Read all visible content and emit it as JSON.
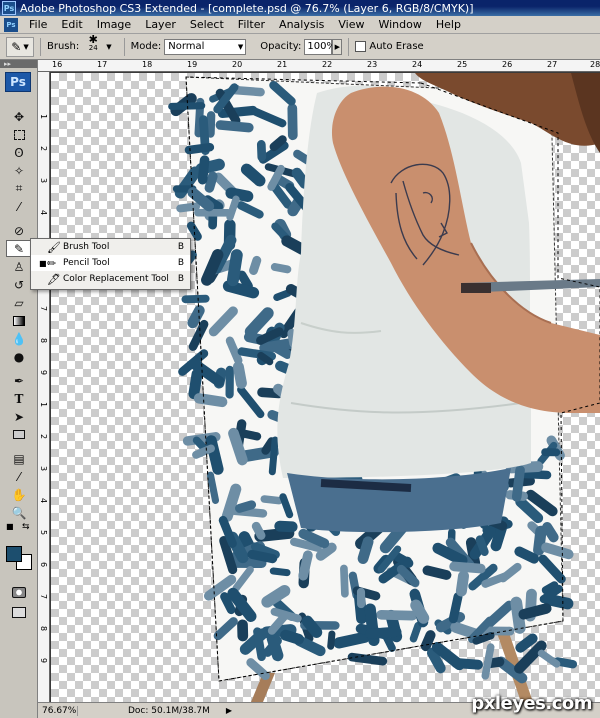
{
  "window": {
    "title": "Adobe Photoshop CS3 Extended - [complete.psd @ 76.7% (Layer 6, RGB/8/CMYK)]",
    "app_badge": "Ps"
  },
  "menubar": {
    "items": [
      "File",
      "Edit",
      "Image",
      "Layer",
      "Select",
      "Filter",
      "Analysis",
      "View",
      "Window",
      "Help"
    ]
  },
  "options": {
    "brush_label": "Brush:",
    "brush_size": "24",
    "mode_label": "Mode:",
    "mode_value": "Normal",
    "opacity_label": "Opacity:",
    "opacity_value": "100%",
    "auto_erase_label": "Auto Erase"
  },
  "toolbox": {
    "logo": "Ps",
    "type_tool_glyph": "T"
  },
  "ruler": {
    "top": [
      "16",
      "17",
      "18",
      "19",
      "20",
      "21",
      "22",
      "23",
      "24",
      "25",
      "26",
      "27",
      "28"
    ],
    "left": [
      "1",
      "2",
      "3",
      "4",
      "5",
      "6",
      "7",
      "8",
      "9",
      "1",
      "2",
      "3",
      "4",
      "5",
      "6",
      "7",
      "8",
      "9",
      "1",
      "2"
    ]
  },
  "flyout": {
    "items": [
      {
        "label": "Brush Tool",
        "key": "B",
        "icon": "brush-icon"
      },
      {
        "label": "Pencil Tool",
        "key": "B",
        "icon": "pencil-icon",
        "selected": true
      },
      {
        "label": "Color Replacement Tool",
        "key": "B",
        "icon": "color-replacement-icon"
      }
    ]
  },
  "statusbar": {
    "zoom": "76.67%",
    "doc": "Doc: 50.1M/38.7M"
  },
  "colors": {
    "foreground": "#1c4e6e",
    "background": "#ffffff",
    "stroke_dark": "#1f4f6f",
    "stroke_mid": "#3f6a88",
    "stroke_light": "#6e8ea5"
  },
  "watermark": "pxleyes.com"
}
